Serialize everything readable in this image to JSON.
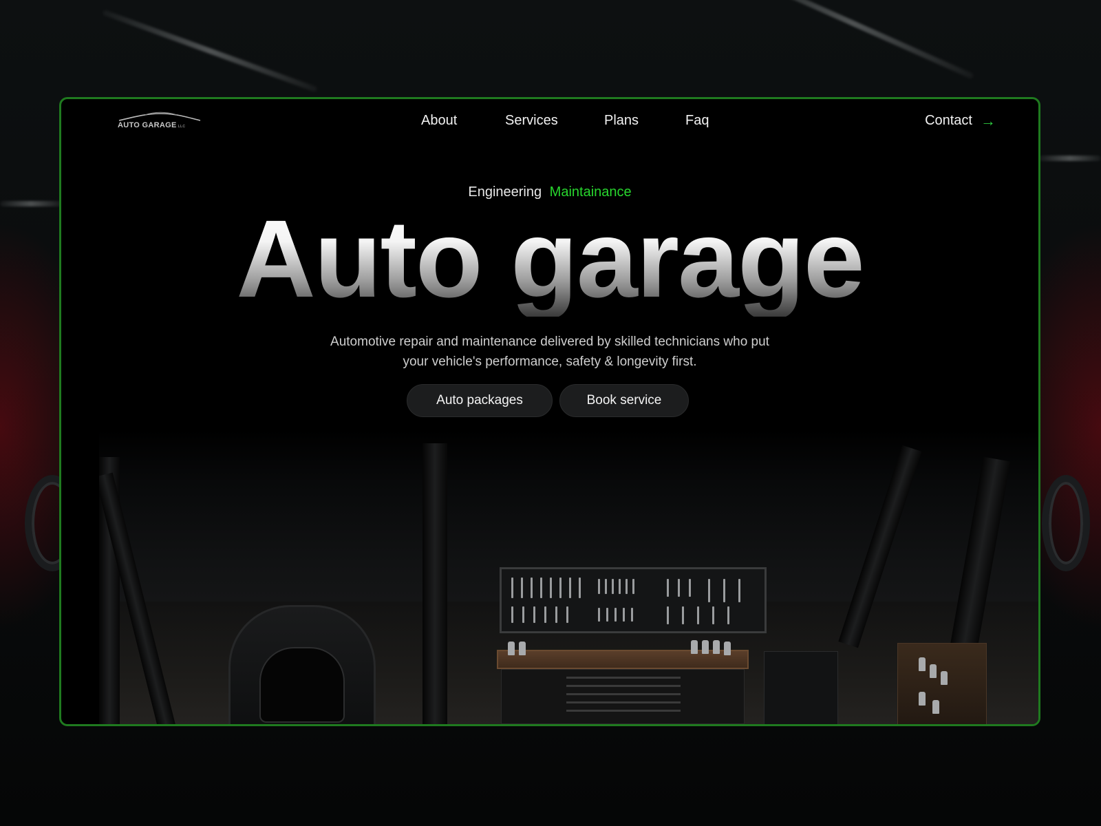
{
  "brand": {
    "logo_text": "AUTO GARAGE",
    "logo_suffix": "LLC"
  },
  "nav": {
    "items": [
      {
        "label": "About"
      },
      {
        "label": "Services"
      },
      {
        "label": "Plans"
      },
      {
        "label": "Faq"
      }
    ],
    "contact_label": "Contact",
    "contact_icon": "arrow-right-icon"
  },
  "hero": {
    "eyebrow": "Engineering",
    "eyebrow_accent": "Maintainance",
    "title": "Auto garage",
    "subtitle_line1": "Automotive repair and maintenance delivered by skilled technicians who put",
    "subtitle_line2": "your vehicle's performance, safety & longevity first.",
    "primary_button": "Auto packages",
    "secondary_button": "Book service"
  },
  "colors": {
    "accent": "#28d62e",
    "frame": "#1f7a1f",
    "background": "#000000",
    "button_bg": "#1c1d1e"
  }
}
